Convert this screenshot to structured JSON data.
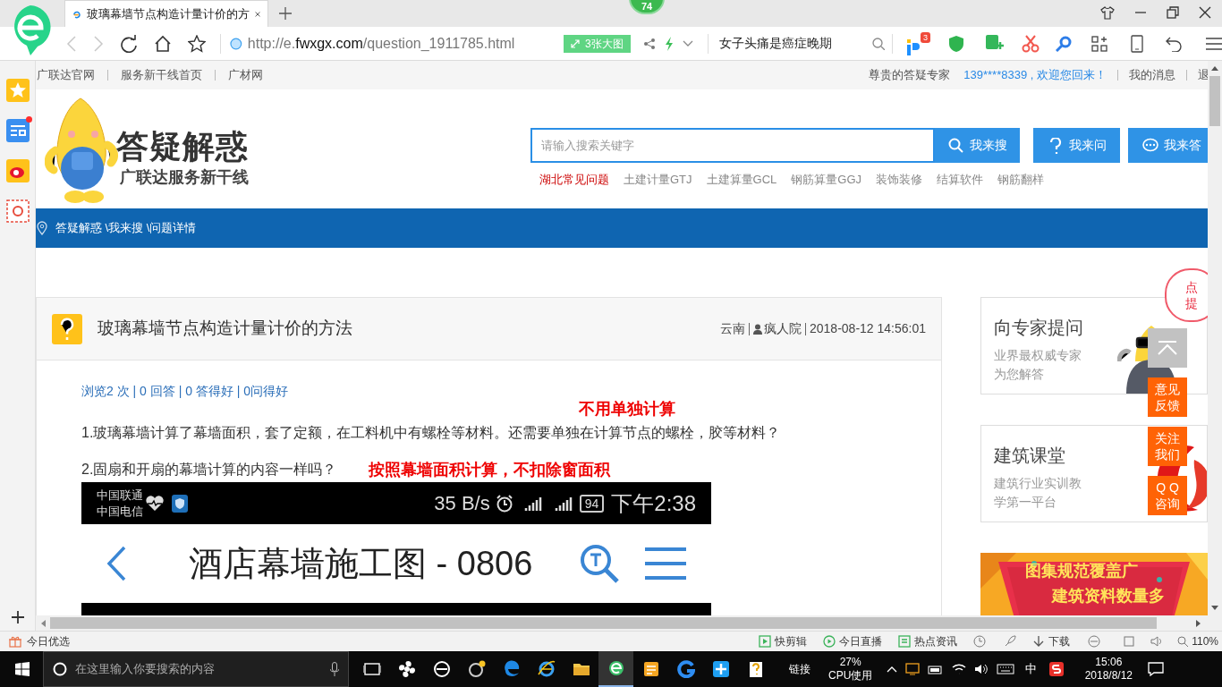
{
  "browser": {
    "tab_title": "玻璃幕墙节点构造计量计价的方",
    "badge": "74",
    "url": {
      "scheme": "http://e.",
      "domain": "fwxgx.com",
      "path": "/question_1911785.html"
    },
    "image_button": "3张大图",
    "search_value": "女子头痛是癌症晚期",
    "extension_badge": "3"
  },
  "top_links": {
    "left": [
      "广联达官网",
      "服务新干线首页",
      "广材网"
    ],
    "greeting": "尊贵的答疑专家",
    "welcome": "139****8339 , 欢迎您回来！",
    "messages": "我的消息",
    "logout": "退"
  },
  "logo": {
    "title": "答疑解惑",
    "subtitle": "广联达服务新干线"
  },
  "search": {
    "placeholder": "请输入搜索关键字",
    "buttons": [
      {
        "kind": "search",
        "label": "我来搜"
      },
      {
        "kind": "ask",
        "label": "我来问"
      },
      {
        "kind": "answer",
        "label": "我来答"
      }
    ],
    "tags": [
      {
        "label": "湖北常见问题",
        "highlighted": true
      },
      {
        "label": "土建计量GTJ",
        "highlighted": false
      },
      {
        "label": "土建算量GCL",
        "highlighted": false
      },
      {
        "label": "钢筋算量GGJ",
        "highlighted": false
      },
      {
        "label": "装饰装修",
        "highlighted": false
      },
      {
        "label": "结算软件",
        "highlighted": false
      },
      {
        "label": "钢筋翻样",
        "highlighted": false
      }
    ]
  },
  "breadcrumb": "答疑解惑 \\我来搜 \\问题详情",
  "question": {
    "title": "玻璃幕墙节点构造计量计价的方法",
    "location": "云南",
    "author": "疯人院",
    "date": "2018-08-12 14:56:01",
    "stats": "浏览2 次 | 0 回答 | 0 答得好 | 0问得好",
    "paragraphs": [
      {
        "note": "不用单独计算",
        "text": "1.玻璃幕墙计算了幕墙面积，套了定额，在工料机中有螺栓等材料。还需要单独在计算节点的螺栓，胶等材料？"
      },
      {
        "text": "2.固扇和开扇的幕墙计算的内容一样吗？",
        "note": "按照幕墙面积计算，不扣除窗面积"
      }
    ],
    "phone": {
      "carriers": [
        "中国联通",
        "中国电信"
      ],
      "speed": "35 B/s",
      "battery": "94",
      "time": "下午2:38",
      "title": "酒店幕墙施工图 - 0806"
    }
  },
  "side_cards": [
    {
      "title": "向专家提问",
      "lines": [
        "业界最权威专家",
        "为您解答"
      ]
    },
    {
      "title": "建筑课堂",
      "lines": [
        "建筑行业实训教",
        "学第一平台"
      ]
    }
  ],
  "cloud": [
    "点",
    "提"
  ],
  "float_buttons": [
    [
      "意见",
      "反馈"
    ],
    [
      "关注",
      "我们"
    ],
    [
      "Q Q",
      "咨询"
    ]
  ],
  "ad": [
    "图集规范覆盖广",
    "建筑资料数量多"
  ],
  "status_bar": {
    "left": "今日优选",
    "items": [
      {
        "kind": "clip",
        "label": "快剪辑"
      },
      {
        "kind": "live",
        "label": "今日直播"
      },
      {
        "kind": "news",
        "label": "热点资讯"
      },
      {
        "kind": "download",
        "label": "下载"
      }
    ],
    "zoom": "110%"
  },
  "taskbar": {
    "search_placeholder": "在这里输入你要搜索的内容",
    "links": "链接",
    "cpu": "27%",
    "cpu_label": "CPU使用",
    "ime": "中",
    "time": "15:06",
    "date": "2018/8/12"
  }
}
